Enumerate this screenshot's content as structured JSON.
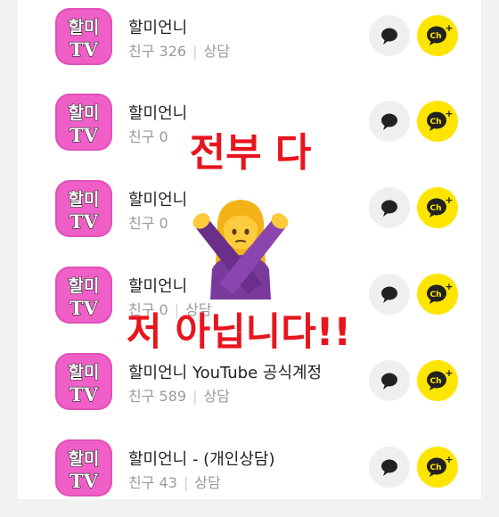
{
  "friends": [
    {
      "name": "할미언니",
      "count": "친구 326",
      "action": "상담"
    },
    {
      "name": "할미언니",
      "count": "친구 0",
      "action": ""
    },
    {
      "name": "할미언니",
      "count": "친구 0",
      "action": ""
    },
    {
      "name": "할미언니",
      "count": "친구 0",
      "action": "상담"
    },
    {
      "name": "할미언니 YouTube 공식계정",
      "count": "친구 589",
      "action": "상담"
    },
    {
      "name": "할미언니 - (개인상담)",
      "count": "친구 43",
      "action": "상담"
    }
  ],
  "logo": {
    "line1": "할미",
    "line2": "TV"
  },
  "channel_button_label": "Ch+",
  "overlay": {
    "top": "전부 다",
    "bottom": "저 아닙니다!!"
  },
  "colors": {
    "logo_bg": "#f05fc8",
    "channel_yellow": "#fee500",
    "overlay_red": "#e8151e",
    "chat_button_bg": "#efefef"
  },
  "icons": {
    "chat": "chat-bubble-icon",
    "channel": "channel-add-icon",
    "gesture": "no-gesture-woman-emoji"
  }
}
